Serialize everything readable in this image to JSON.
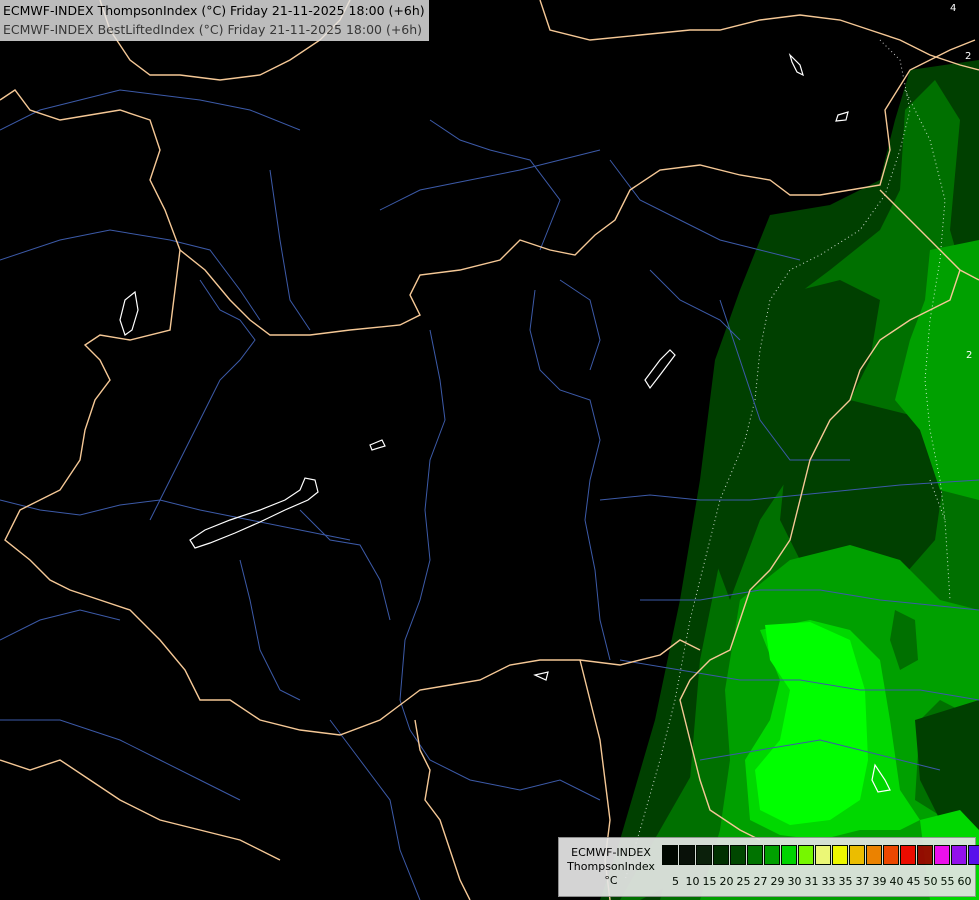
{
  "header": {
    "line1": "ECMWF-INDEX ThompsonIndex (°C) Friday 21-11-2025 18:00 (+6h)",
    "line2": "ECMWF-INDEX BestLiftedIndex (°C) Friday 21-11-2025 18:00 (+6h)"
  },
  "legend": {
    "line1": "ECMWF-INDEX",
    "line2": "ThompsonIndex",
    "unit": "°C",
    "colors": [
      "#000000",
      "#0a0a0a",
      "#0c1a0c",
      "#002800",
      "#004000",
      "#007000",
      "#00a000",
      "#00d800",
      "#80ff00",
      "#ffff80",
      "#ffff00",
      "#ffc000",
      "#ff8000",
      "#ff4000",
      "#ff0000",
      "#a00000",
      "#ff00ff",
      "#a000ff",
      "#6000ff",
      "#0000ff"
    ],
    "ticks": [
      "5",
      "10",
      "15",
      "20",
      "25",
      "27",
      "29",
      "30",
      "31",
      "33",
      "35",
      "37",
      "39",
      "40",
      "45",
      "50",
      "55",
      "60"
    ]
  },
  "contour_labels": [
    "4",
    "2",
    "2"
  ],
  "colors": {
    "background": "#000000",
    "borders": "#f5c896",
    "rivers": "#3c5aa8",
    "lakes": "#ffffff",
    "green_dark": "#004000",
    "green_mid": "#007000",
    "green_bright": "#00a000",
    "green_light": "#00d800",
    "green_lime": "#00ff00"
  }
}
